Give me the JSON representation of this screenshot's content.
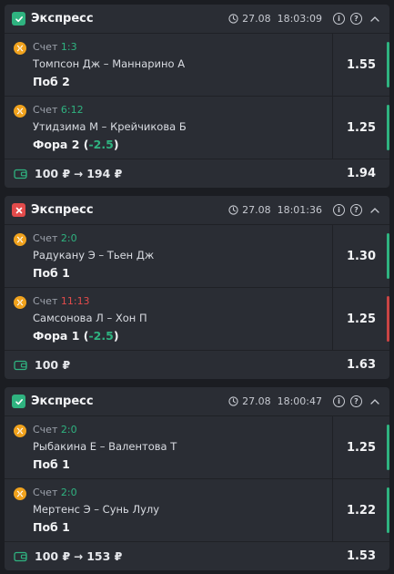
{
  "bets": [
    {
      "status": "won",
      "title": "Экспресс",
      "date": "27.08",
      "time": "18:03:09",
      "events": [
        {
          "score_label": "Счет",
          "score": "1:3",
          "score_color": "green",
          "teams": "Томпсон Дж – Маннарино А",
          "pick": "Поб 2",
          "handicap": "",
          "odds": "1.55",
          "result": "green"
        },
        {
          "score_label": "Счет",
          "score": "6:12",
          "score_color": "green",
          "teams": "Утидзима М – Крейчикова Б",
          "pick": "Фора 2 (",
          "handicap": "-2.5",
          "pick_suffix": ")",
          "odds": "1.25",
          "result": "green"
        }
      ],
      "stake": "100 ₽",
      "arrow": "→",
      "payout": "194 ₽",
      "total_odds": "1.94"
    },
    {
      "status": "lost",
      "title": "Экспресс",
      "date": "27.08",
      "time": "18:01:36",
      "events": [
        {
          "score_label": "Счет",
          "score": "2:0",
          "score_color": "green",
          "teams": "Радукану Э – Тьен Дж",
          "pick": "Поб 1",
          "handicap": "",
          "odds": "1.30",
          "result": "green"
        },
        {
          "score_label": "Счет",
          "score": "11:13",
          "score_color": "red",
          "teams": "Самсонова Л – Хон П",
          "pick": "Фора 1 (",
          "handicap": "-2.5",
          "pick_suffix": ")",
          "odds": "1.25",
          "result": "red"
        }
      ],
      "stake": "100 ₽",
      "arrow": "",
      "payout": "",
      "total_odds": "1.63"
    },
    {
      "status": "won",
      "title": "Экспресс",
      "date": "27.08",
      "time": "18:00:47",
      "events": [
        {
          "score_label": "Счет",
          "score": "2:0",
          "score_color": "green",
          "teams": "Рыбакина Е – Валентова Т",
          "pick": "Поб 1",
          "handicap": "",
          "odds": "1.25",
          "result": "green"
        },
        {
          "score_label": "Счет",
          "score": "2:0",
          "score_color": "green",
          "teams": "Мертенс Э – Сунь Лулу",
          "pick": "Поб 1",
          "handicap": "",
          "odds": "1.22",
          "result": "green"
        }
      ],
      "stake": "100 ₽",
      "arrow": "→",
      "payout": "153 ₽",
      "total_odds": "1.53"
    }
  ],
  "icons": {
    "clock": "clock-icon",
    "info": "info-icon",
    "help": "help-icon",
    "collapse": "chevron-up-icon",
    "sport": "tennis-ball-icon",
    "wallet": "wallet-icon",
    "status_won": "checkmark-icon",
    "status_lost": "cross-icon"
  },
  "colors": {
    "background": "#1b1d22",
    "card": "#2a2d34",
    "win": "#2fb380",
    "loss": "#e24b4b",
    "sport_icon": "#f0a21d"
  },
  "labels": {
    "info": "i",
    "help": "?"
  }
}
